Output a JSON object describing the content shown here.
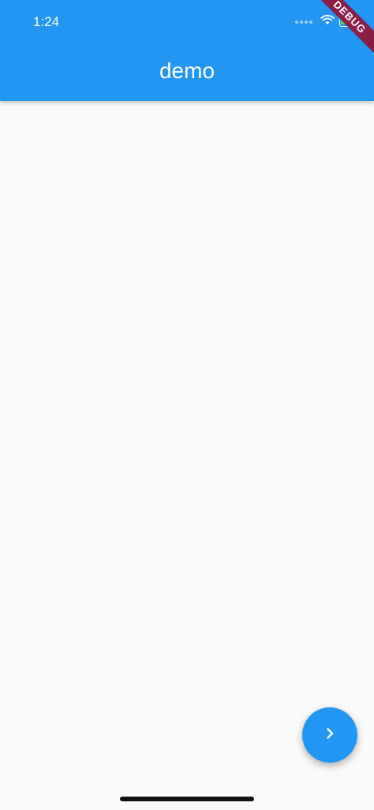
{
  "status_bar": {
    "time": "1:24",
    "icons": [
      "signal-dots-icon",
      "wifi-icon",
      "battery-icon"
    ],
    "battery_color": "#4cd964"
  },
  "app_bar": {
    "title": "demo",
    "background_color": "#2196f3"
  },
  "debug_banner": {
    "label": "DEBUG",
    "color": "#8b1e46"
  },
  "fab": {
    "icon": "chevron-right-icon",
    "color": "#2196f3"
  },
  "body": {
    "background_color": "#fafafb"
  }
}
